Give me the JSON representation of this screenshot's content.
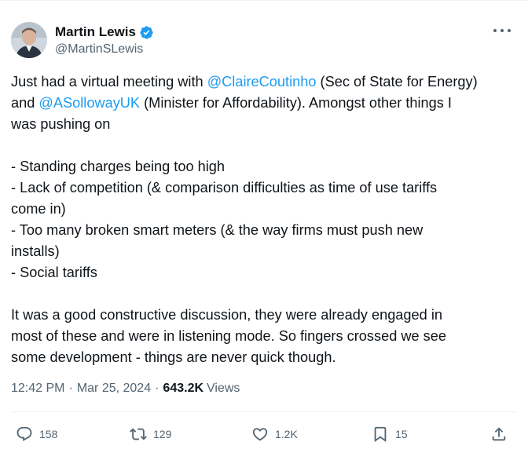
{
  "author": {
    "display_name": "Martin Lewis",
    "handle": "@MartinSLewis",
    "verified": true
  },
  "tweet": {
    "line1_pre": "Just had a virtual meeting with ",
    "mention1": "@ClaireCoutinho",
    "line1_post": " (Sec of State for Energy)",
    "line2_pre": "and ",
    "mention2": "@ASollowayUK",
    "line2_post": " (Minister for Affordability).  Amongst other things I",
    "line3": "was pushing on",
    "bullet1": "- Standing charges being too high",
    "bullet2a": "- Lack of competition (& comparison difficulties as time of use tariffs",
    "bullet2b": "come in)",
    "bullet3a": "- Too many broken smart meters (& the way firms must push new",
    "bullet3b": "installs)",
    "bullet4": "- Social tariffs",
    "para2_l1": "It was a good constructive discussion, they were already engaged in",
    "para2_l2": "most of these and were in listening mode. So fingers crossed we see",
    "para2_l3": "some development - things are never quick though."
  },
  "meta": {
    "time": "12:42 PM",
    "separator": "·",
    "date": "Mar 25, 2024",
    "views_count": "643.2K",
    "views_label": "Views"
  },
  "actions": {
    "replies": "158",
    "reposts": "129",
    "likes": "1.2K",
    "bookmarks": "15"
  },
  "colors": {
    "accent": "#1d9bf0",
    "text": "#0f1419",
    "secondary": "#536471",
    "divider": "#eff3f4"
  },
  "icons": [
    "verified-badge-icon",
    "more-icon",
    "reply-icon",
    "repost-icon",
    "like-icon",
    "bookmark-icon",
    "share-icon"
  ]
}
